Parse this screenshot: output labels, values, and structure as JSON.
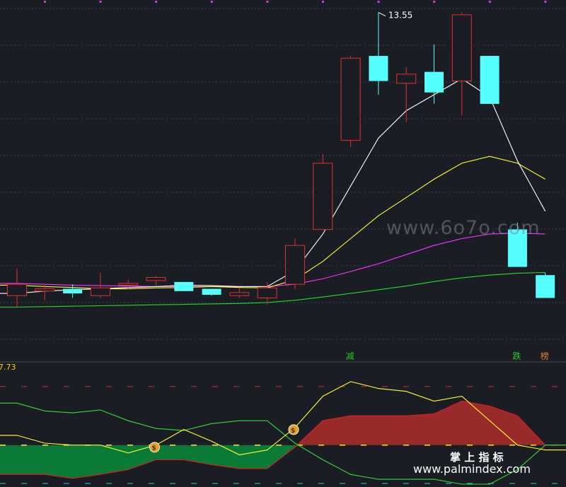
{
  "chart_data": [
    {
      "type": "candlestick",
      "title": "",
      "high_label": "13.55",
      "colors": {
        "up": "#e03030",
        "down": "#55ffff",
        "ma5": "#ffffff",
        "ma10": "#ffff33",
        "ma20": "#ff33ff",
        "ma60": "#22dd22",
        "grid": "#3a4050"
      },
      "candles": [
        {
          "o": 7.35,
          "h": 7.95,
          "l": 7.1,
          "c": 7.6
        },
        {
          "o": 7.45,
          "h": 7.6,
          "l": 7.25,
          "c": 7.5
        },
        {
          "o": 7.5,
          "h": 7.6,
          "l": 7.3,
          "c": 7.4
        },
        {
          "o": 7.35,
          "h": 7.85,
          "l": 7.3,
          "c": 7.52
        },
        {
          "o": 7.58,
          "h": 7.7,
          "l": 7.5,
          "c": 7.62
        },
        {
          "o": 7.68,
          "h": 7.78,
          "l": 7.58,
          "c": 7.75
        },
        {
          "o": 7.65,
          "h": 7.65,
          "l": 7.45,
          "c": 7.45
        },
        {
          "o": 7.5,
          "h": 7.5,
          "l": 7.35,
          "c": 7.37
        },
        {
          "o": 7.35,
          "h": 7.52,
          "l": 7.3,
          "c": 7.42
        },
        {
          "o": 7.3,
          "h": 7.65,
          "l": 7.15,
          "c": 7.52
        },
        {
          "o": 7.6,
          "h": 8.6,
          "l": 7.5,
          "c": 8.45
        },
        {
          "o": 8.8,
          "h": 10.45,
          "l": 8.8,
          "c": 10.25
        },
        {
          "o": 10.75,
          "h": 12.6,
          "l": 10.6,
          "c": 12.55
        },
        {
          "o": 12.6,
          "h": 13.55,
          "l": 11.75,
          "c": 12.05
        },
        {
          "o": 12.0,
          "h": 12.35,
          "l": 11.15,
          "c": 12.2
        },
        {
          "o": 12.25,
          "h": 12.85,
          "l": 11.55,
          "c": 11.8
        },
        {
          "o": 12.05,
          "h": 13.55,
          "l": 11.3,
          "c": 13.5
        },
        {
          "o": 12.6,
          "h": 12.6,
          "l": 11.55,
          "c": 11.55
        },
        {
          "o": 8.8,
          "h": 8.95,
          "l": 7.98,
          "c": 7.98
        },
        {
          "o": 7.8,
          "h": 7.85,
          "l": 7.3,
          "c": 7.3
        }
      ],
      "ma5": [
        7.4,
        7.45,
        7.48,
        7.5,
        7.53,
        7.55,
        7.58,
        7.57,
        7.55,
        7.55,
        7.9,
        8.7,
        9.75,
        10.8,
        11.4,
        11.75,
        12.1,
        11.7,
        10.3,
        9.2
      ],
      "ma10": [
        7.58,
        7.55,
        7.53,
        7.5,
        7.5,
        7.52,
        7.53,
        7.55,
        7.53,
        7.52,
        7.7,
        8.1,
        8.6,
        9.1,
        9.5,
        9.9,
        10.25,
        10.4,
        10.25,
        9.9
      ],
      "ma20": [
        7.62,
        7.6,
        7.58,
        7.57,
        7.56,
        7.55,
        7.55,
        7.55,
        7.55,
        7.55,
        7.6,
        7.72,
        7.88,
        8.05,
        8.25,
        8.45,
        8.6,
        8.7,
        8.72,
        8.7
      ],
      "ma60": [
        7.1,
        7.11,
        7.12,
        7.13,
        7.14,
        7.15,
        7.16,
        7.17,
        7.18,
        7.2,
        7.25,
        7.32,
        7.4,
        7.48,
        7.56,
        7.66,
        7.74,
        7.8,
        7.84,
        7.86
      ],
      "markers": [
        {
          "i": 12,
          "text": "减",
          "color": "#22cc22"
        },
        {
          "i": 18,
          "text": "跌",
          "color": "#22cc22"
        },
        {
          "i": 19,
          "text": "榜",
          "color": "#e08030"
        }
      ],
      "ylim": [
        6.55,
        13.7
      ]
    },
    {
      "type": "area",
      "title": "",
      "top_value_label": "7.73",
      "ylim": [
        -40,
        70
      ],
      "levels": [
        60,
        0,
        -45
      ],
      "fill_pos": "#9a2a2a",
      "fill_neg": "#0b7a36",
      "yellow": [
        10,
        2,
        0,
        0,
        -8,
        0,
        16,
        4,
        -10,
        -5,
        18,
        50,
        65,
        58,
        55,
        45,
        50,
        25,
        0,
        -5
      ],
      "green": [
        43,
        35,
        33,
        36,
        25,
        17,
        15,
        22,
        25,
        25,
        2,
        -15,
        -30,
        -35,
        -35,
        -35,
        -40,
        -40,
        -25,
        0
      ],
      "red": [
        -30,
        -30,
        -34,
        -30,
        -25,
        -15,
        -15,
        -20,
        -24,
        -24,
        -2,
        25,
        30,
        30,
        30,
        32,
        45,
        40,
        30,
        0
      ],
      "coin_markers": [
        5,
        10
      ]
    }
  ],
  "watermark": {
    "site1": "www.6o7o.com",
    "cn": "掌 上 指 标",
    "site2": "www.palmindex.com"
  }
}
